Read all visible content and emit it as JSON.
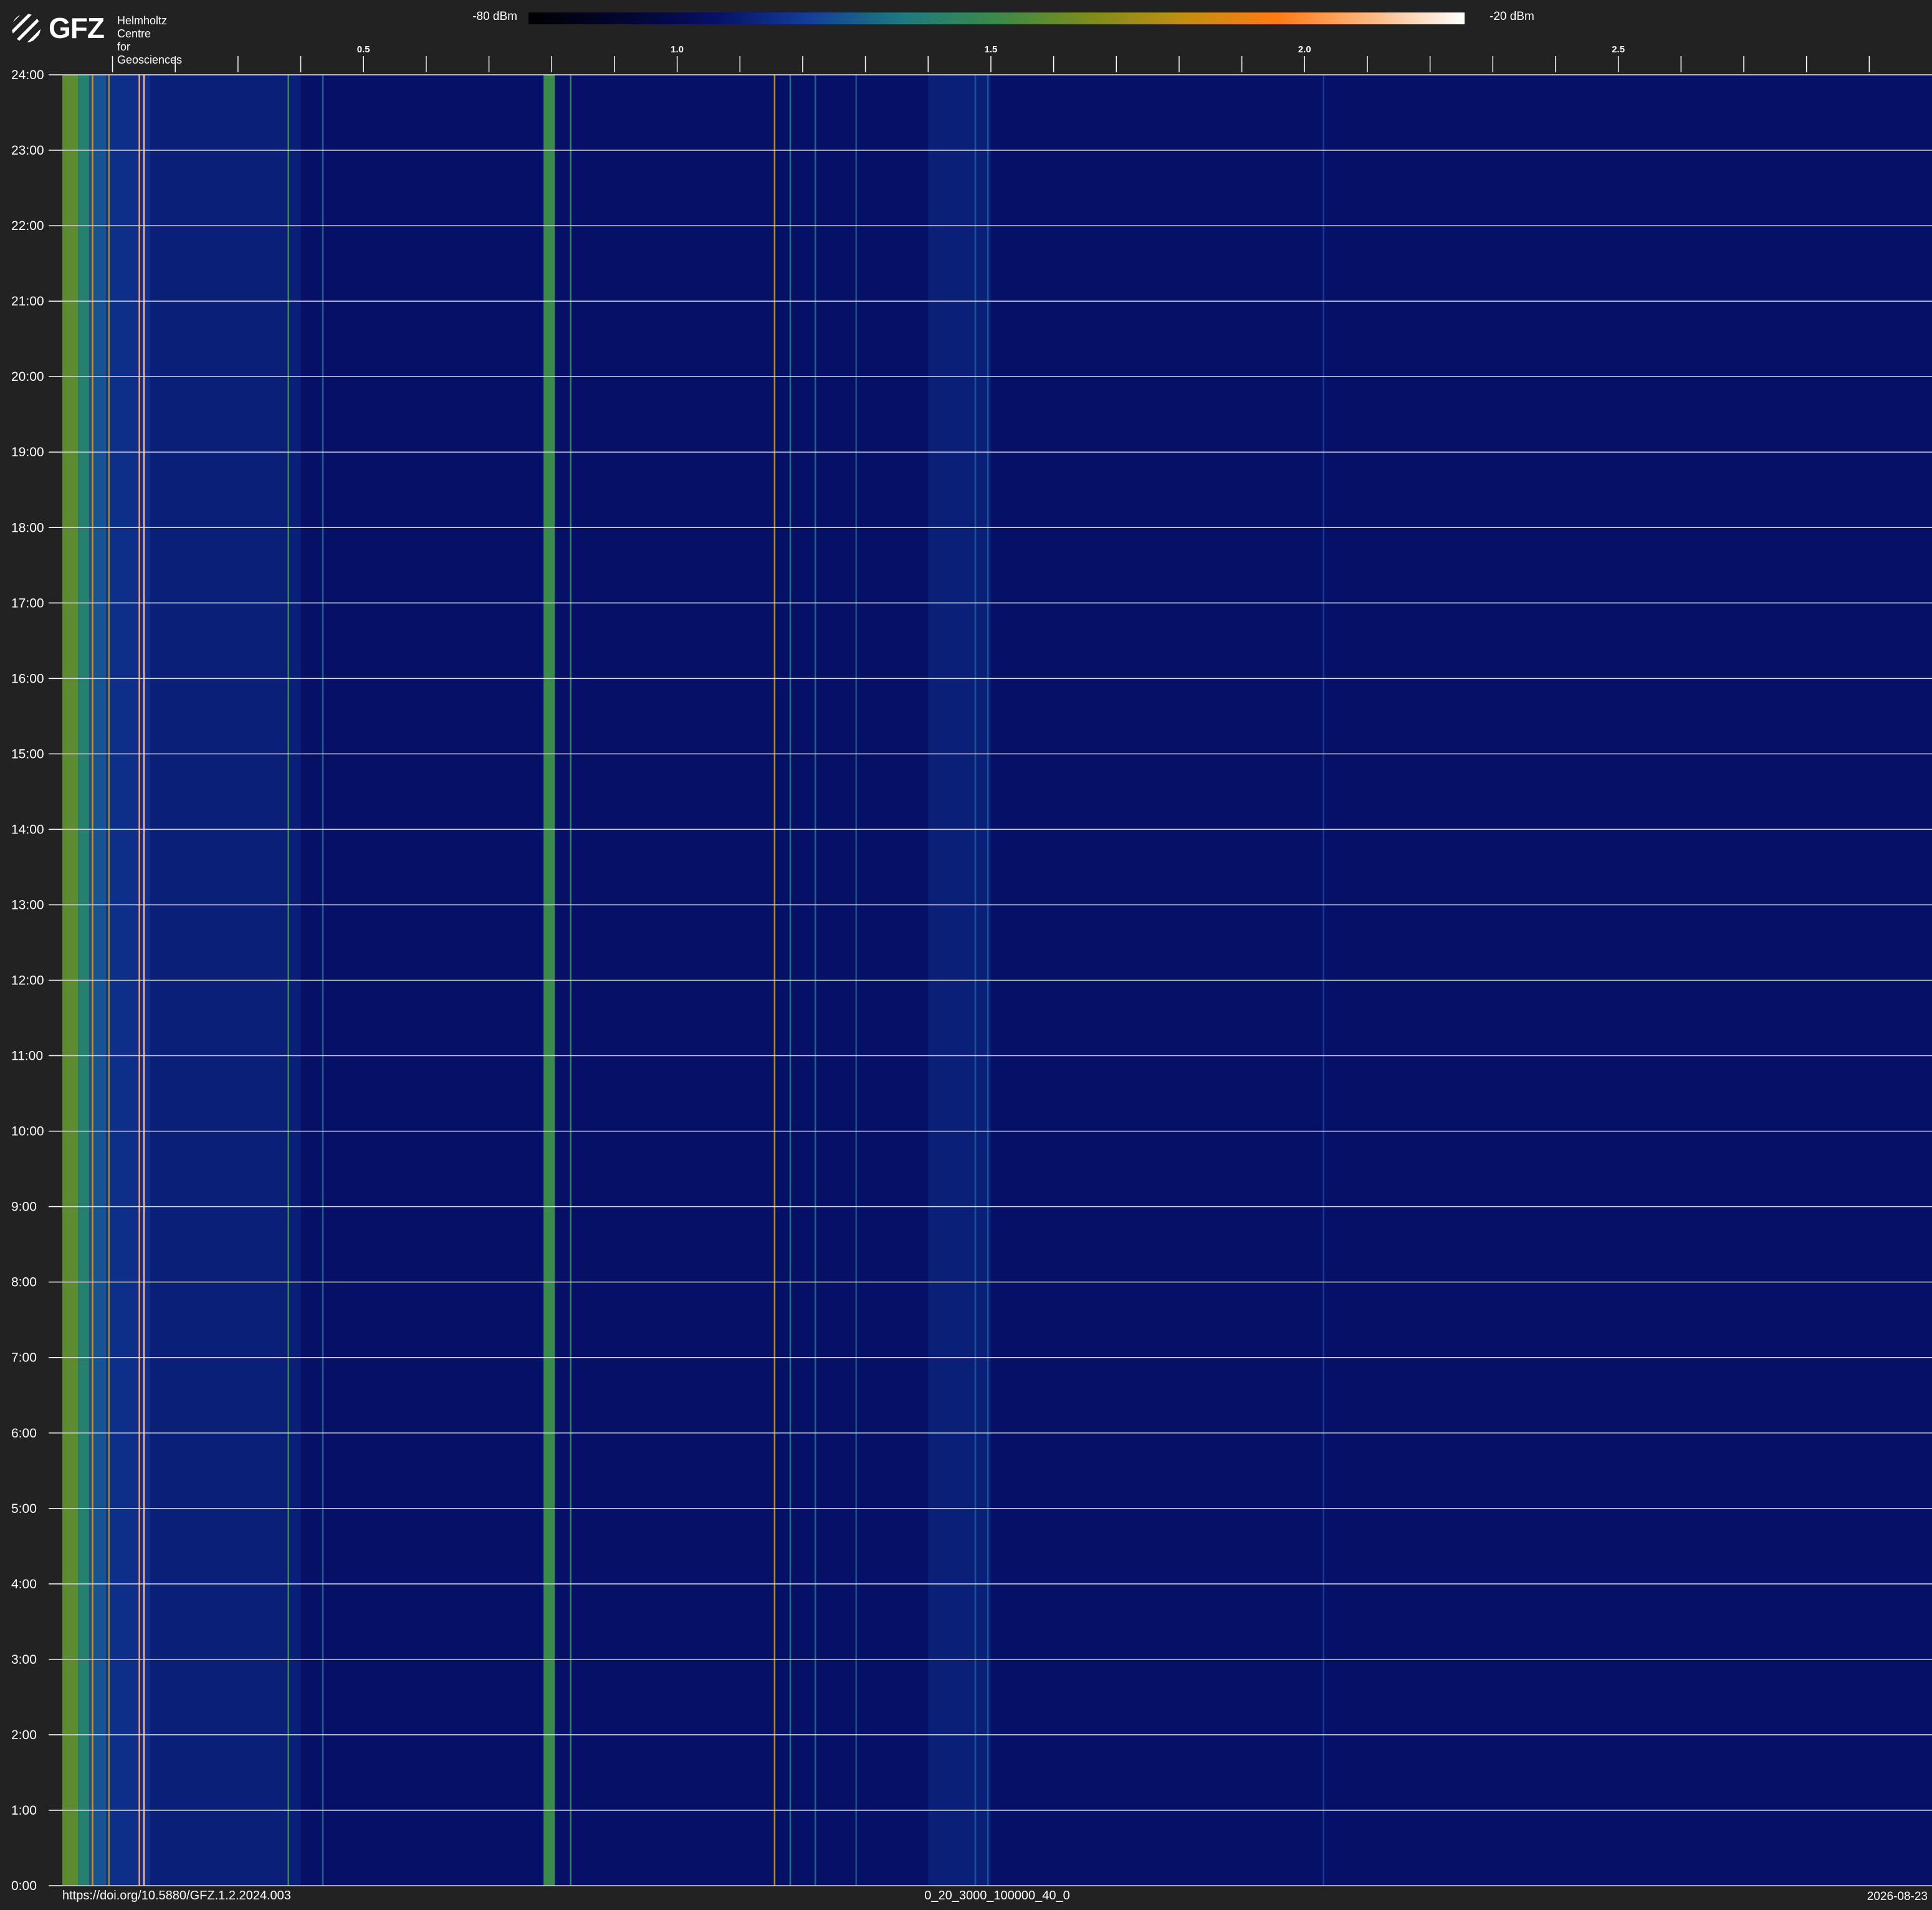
{
  "logo": {
    "text": "GFZ",
    "org_line1": "Helmholtz Centre",
    "org_line2": "for Geosciences"
  },
  "colorbar": {
    "min_label": "-80 dBm",
    "max_label": "-20 dBm",
    "colors": [
      "#000000",
      "#03052f",
      "#061067",
      "#123f9a",
      "#1e7a80",
      "#3a8a4a",
      "#7e8c1a",
      "#c28e10",
      "#ff7a12",
      "#ffb880",
      "#ffffff"
    ]
  },
  "footer": {
    "doi": "https://doi.org/10.5880/GFZ.1.2.2024.003",
    "id": "0_20_3000_100000_40_0",
    "date": "2026-08-23"
  },
  "chart_data": {
    "type": "heatmap",
    "title": "",
    "xlabel": "",
    "ylabel": "",
    "x_range": [
      0.02,
      3.0
    ],
    "x_ticks": [
      0.1,
      0.2,
      0.3,
      0.4,
      0.5,
      0.6,
      0.7,
      0.8,
      0.9,
      1.0,
      1.1,
      1.2,
      1.3,
      1.4,
      1.5,
      1.6,
      1.7,
      1.8,
      1.9,
      2.0,
      2.1,
      2.2,
      2.3,
      2.4,
      2.5,
      2.6,
      2.7,
      2.8,
      2.9
    ],
    "x_tick_labels": [
      {
        "x": 0.5,
        "label": "0.5"
      },
      {
        "x": 1.0,
        "label": "1.0"
      },
      {
        "x": 1.5,
        "label": "1.5"
      },
      {
        "x": 2.0,
        "label": "2.0"
      },
      {
        "x": 2.5,
        "label": "2.5"
      }
    ],
    "y_range": [
      0,
      24
    ],
    "y_ticks": [
      {
        "hour": 24,
        "label": "24:00"
      },
      {
        "hour": 23,
        "label": "23:00"
      },
      {
        "hour": 22,
        "label": "22:00"
      },
      {
        "hour": 21,
        "label": "21:00"
      },
      {
        "hour": 20,
        "label": "20:00"
      },
      {
        "hour": 19,
        "label": "19:00"
      },
      {
        "hour": 18,
        "label": "18:00"
      },
      {
        "hour": 17,
        "label": "17:00"
      },
      {
        "hour": 16,
        "label": "16:00"
      },
      {
        "hour": 15,
        "label": "15:00"
      },
      {
        "hour": 14,
        "label": "14:00"
      },
      {
        "hour": 13,
        "label": "13:00"
      },
      {
        "hour": 12,
        "label": "12:00"
      },
      {
        "hour": 11,
        "label": "11:00"
      },
      {
        "hour": 10,
        "label": "10:00"
      },
      {
        "hour": 9,
        "label": "9:00"
      },
      {
        "hour": 8,
        "label": "8:00"
      },
      {
        "hour": 7,
        "label": "7:00"
      },
      {
        "hour": 6,
        "label": "6:00"
      },
      {
        "hour": 5,
        "label": "5:00"
      },
      {
        "hour": 4,
        "label": "4:00"
      },
      {
        "hour": 3,
        "label": "3:00"
      },
      {
        "hour": 2,
        "label": "2:00"
      },
      {
        "hour": 1,
        "label": "1:00"
      },
      {
        "hour": 0,
        "label": "0:00"
      }
    ],
    "grid": true,
    "value_range_dbm": [
      -80,
      -20
    ],
    "background_dbm": -68,
    "bands": [
      {
        "x0": 0.02,
        "x1": 0.045,
        "dbm": -47
      },
      {
        "x0": 0.045,
        "x1": 0.063,
        "dbm": -54
      },
      {
        "x0": 0.063,
        "x1": 0.09,
        "dbm": -60
      },
      {
        "x0": 0.09,
        "x1": 0.16,
        "dbm": -64
      },
      {
        "x0": 0.16,
        "x1": 0.4,
        "dbm": -66
      },
      {
        "x0": 0.787,
        "x1": 0.805,
        "dbm": -50
      },
      {
        "x0": 1.4,
        "x1": 1.5,
        "dbm": -66
      }
    ],
    "lines": [
      {
        "x": 0.068,
        "dbm": -35
      },
      {
        "x": 0.094,
        "dbm": -40
      },
      {
        "x": 0.1425,
        "dbm": -28
      },
      {
        "x": 0.15,
        "dbm": -26
      },
      {
        "x": 0.38,
        "dbm": -50
      },
      {
        "x": 0.435,
        "dbm": -58
      },
      {
        "x": 0.83,
        "dbm": -52
      },
      {
        "x": 1.155,
        "dbm": -40
      },
      {
        "x": 1.18,
        "dbm": -56
      },
      {
        "x": 1.22,
        "dbm": -58
      },
      {
        "x": 1.285,
        "dbm": -60
      },
      {
        "x": 1.475,
        "dbm": -60
      },
      {
        "x": 1.495,
        "dbm": -60
      },
      {
        "x": 2.03,
        "dbm": -62
      }
    ]
  }
}
